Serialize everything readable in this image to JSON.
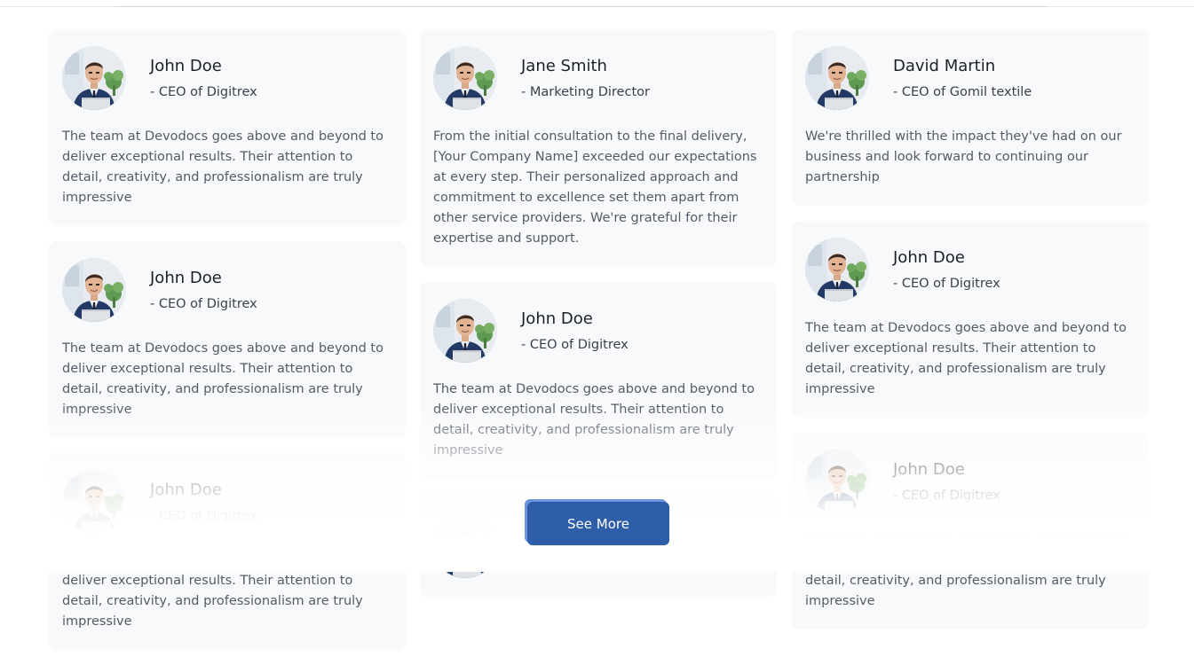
{
  "testimonials": {
    "col1": [
      {
        "name": "John Doe",
        "role": "- CEO of Digitrex",
        "quote": "The team at Devodocs goes above and beyond to deliver exceptional results. Their attention to detail, creativity, and professionalism are truly impressive"
      },
      {
        "name": "John Doe",
        "role": "- CEO of Digitrex",
        "quote": "The team at Devodocs goes above and beyond to deliver exceptional results. Their attention to detail, creativity, and professionalism are truly impressive"
      },
      {
        "name": "John Doe",
        "role": "- CEO of Digitrex",
        "quote": "The team at Devodocs goes above and beyond to deliver exceptional results. Their attention to detail, creativity, and professionalism are truly impressive"
      }
    ],
    "col2": [
      {
        "name": "Jane Smith",
        "role": "- Marketing Director",
        "quote": "From the initial consultation to the final delivery, [Your Company Name] exceeded our expectations at every step. Their personalized approach and commitment to excellence set them apart from other service providers. We're grateful for their expertise and support."
      },
      {
        "name": "John Doe",
        "role": "- CEO of Digitrex",
        "quote": "The team at Devodocs goes above and beyond to deliver exceptional results. Their attention to detail, creativity, and professionalism are truly impressive"
      }
    ],
    "col3": [
      {
        "name": "David Martin",
        "role": "- CEO of Gomil textile",
        "quote": "We're thrilled with the impact they've had on our business and look forward to continuing our partnership"
      },
      {
        "name": "John Doe",
        "role": "- CEO of Digitrex",
        "quote": "The team at Devodocs goes above and beyond to deliver exceptional results. Their attention to detail, creativity, and professionalism are truly impressive"
      },
      {
        "name": "John Doe",
        "role": "- CEO of Digitrex",
        "quote": "The team at Devodocs goes above and beyond to deliver exceptional results. Their attention to detail, creativity, and professionalism are truly impressive"
      }
    ]
  },
  "see_more_label": "See More",
  "colors": {
    "card_bg": "#f8f9fb",
    "button_bg": "#2f5ea9",
    "button_accent": "#6b95de",
    "text_dark": "#1c1f2a",
    "text_muted": "#555a66"
  },
  "icons": {
    "avatar": "avatar-photo"
  }
}
